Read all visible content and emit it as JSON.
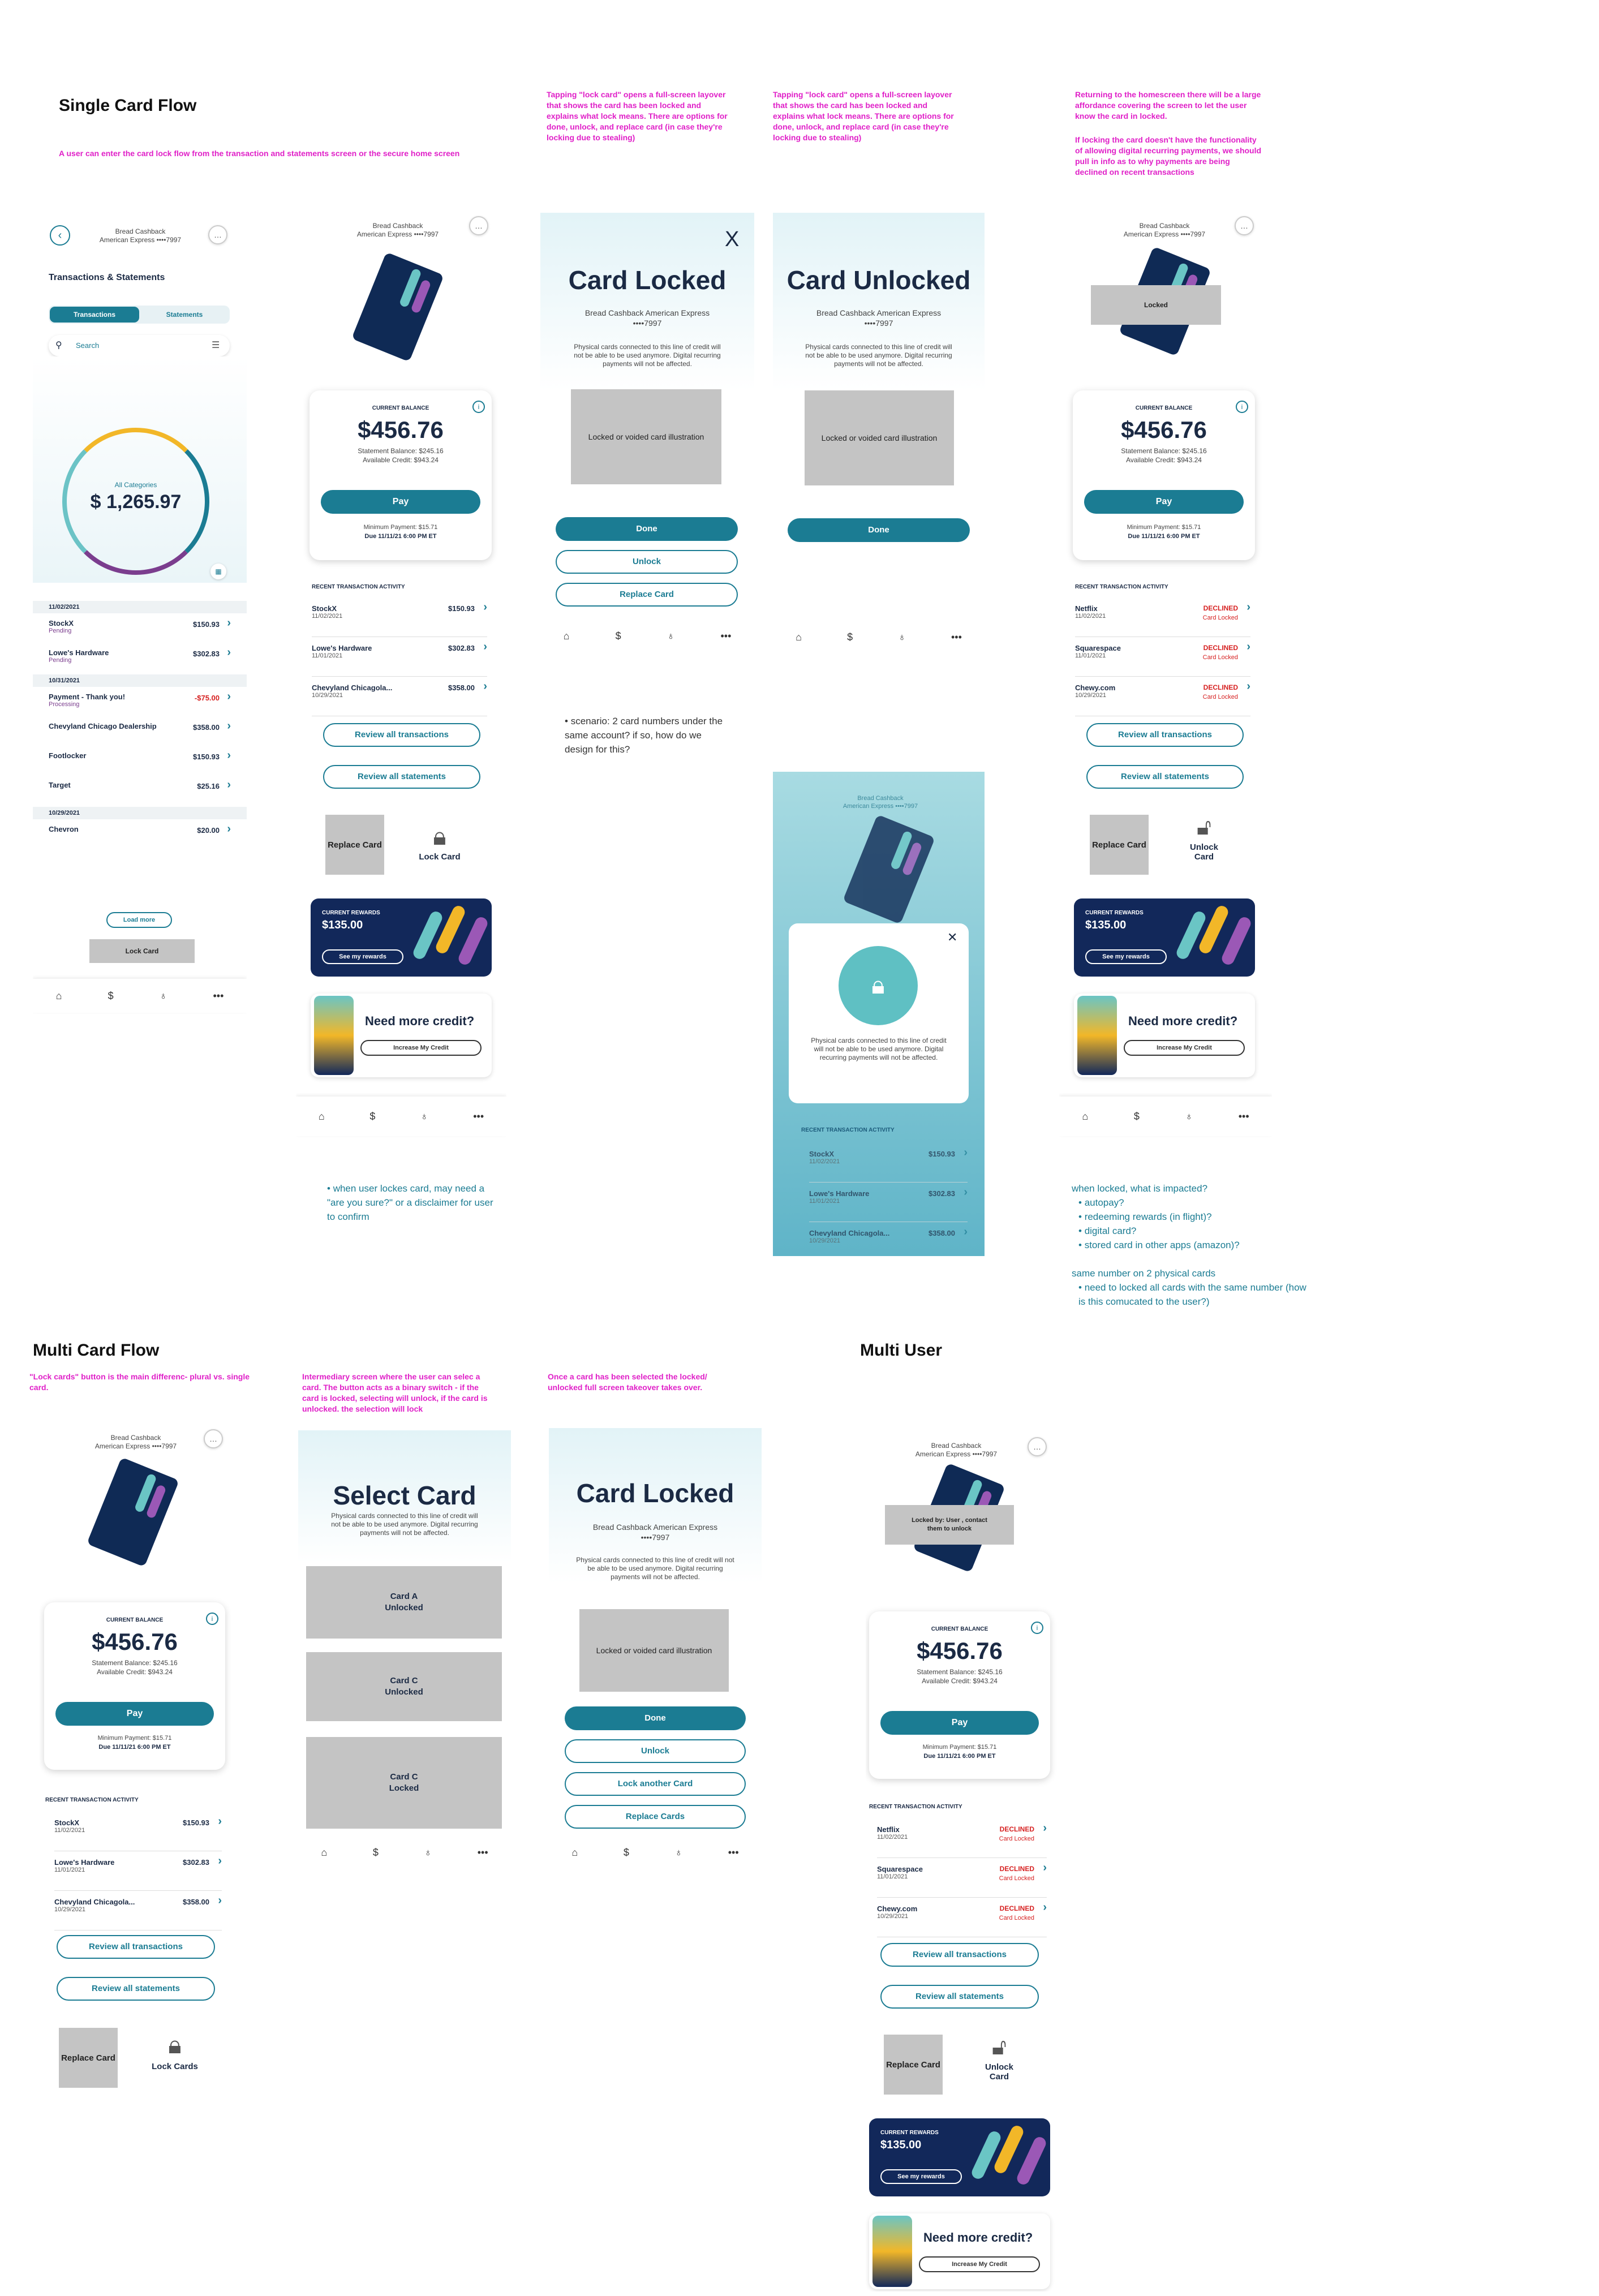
{
  "headers": {
    "single": "Single Card Flow",
    "multi": "Multi Card Flow",
    "multiuser": "Multi  User"
  },
  "notes": {
    "single_intro": "A user can enter the card lock flow from the transaction and statements screen or the secure home screen",
    "lock_overlay": "Tapping \"lock card\" opens a full-screen layover that shows the card has been locked and explains what lock means. There are options for done, unlock, and replace card (in case they're locking due to stealing)",
    "unlock_overlay": "Tapping \"lock card\" opens a full-screen layover that shows the card has been locked and explains what lock means. There are options for done, unlock, and replace card (in case they're locking due to stealing)",
    "home_return": "Returning to the homescreen there will be a large affordance covering the screen to let the user know the card in locked.",
    "home_return2": "If locking the card doesn't have the functionality of allowing digital recurring payments, we should pull in info as to why payments are being declined on recent transactions",
    "multi_intro": "\"Lock cards\" button is the main differenc- plural vs. single card.",
    "select_intro": "Intermediary screen where the user can selec a card. The button acts as a binary switch - if the card is locked, selecting will unlock, if the card is unlocked. the selection will lock",
    "takeover": "Once a card has been selected the locked/ unlocked full screen takeover takes over."
  },
  "comments": {
    "scenario": "scenario: 2 card numbers under the same account? if so, how do we design for this?",
    "confirm": "when user lockes card, may need a \"are you sure?\" or a disclaimer for user to confirm",
    "impacted_title": "when locked, what is impacted?",
    "impacted": [
      "autopay?",
      "redeeming rewards (in flight)?",
      "digital card?",
      "stored card in other apps (amazon)?"
    ],
    "same_number": "same number on 2 physical cards",
    "same_number_sub": "need to locked all cards with the same number (how is this comucated to the user?)"
  },
  "account": {
    "name": "Bread Cashback",
    "number": "American Express ••••7997",
    "full": "Bread Cashback American Express ••••7997"
  },
  "balance": {
    "label": "CURRENT BALANCE",
    "amount": "$456.76",
    "statement": "Statement Balance: $245.16",
    "available": "Available Credit: $943.24",
    "pay": "Pay",
    "minimum": "Minimum Payment: $15.71",
    "due": "Due 11/11/21 6:00 PM ET"
  },
  "recent_label": "RECENT TRANSACTION ACTIVITY",
  "recent": [
    {
      "name": "StockX",
      "date": "11/02/2021",
      "amount": "$150.93"
    },
    {
      "name": "Lowe's Hardware",
      "date": "11/01/2021",
      "amount": "$302.83"
    },
    {
      "name": "Chevyland Chicagola...",
      "date": "10/29/2021",
      "amount": "$358.00"
    }
  ],
  "declined": [
    {
      "name": "Netflix",
      "date": "11/02/2021"
    },
    {
      "name": "Squarespace",
      "date": "11/01/2021"
    },
    {
      "name": "Chewy.com",
      "date": "10/29/2021"
    }
  ],
  "declined_label": "DECLINED",
  "card_locked_label": "Card Locked",
  "review_tx": "Review all transactions",
  "review_st": "Review all statements",
  "replace_card": "Replace Card",
  "lock_card": "Lock Card",
  "unlock_card": "Unlock Card",
  "lock_cards": "Lock Cards",
  "rewards": {
    "label": "CURRENT REWARDS",
    "amount": "$135.00",
    "btn": "See my rewards"
  },
  "credit": {
    "title": "Need more credit?",
    "btn": "Increase My Credit"
  },
  "locked_badge": "Locked",
  "locked_by": "Locked by: User , contact them to unlock",
  "tx_screen": {
    "title": "Transactions & Statements",
    "tab1": "Transactions",
    "tab2": "Statements",
    "search": "Search",
    "categories": "All Categories",
    "total": "$ 1,265.97",
    "groups": [
      {
        "date": "11/02/2021",
        "items": [
          {
            "name": "StockX",
            "sub": "Pending",
            "amount": "$150.93"
          },
          {
            "name": "Lowe's Hardware",
            "sub": "Pending",
            "amount": "$302.83"
          }
        ]
      },
      {
        "date": "10/31/2021",
        "items": [
          {
            "name": "Payment - Thank you!",
            "sub": "Processing",
            "amount": "-$75.00"
          },
          {
            "name": "Chevyland Chicago Dealership",
            "sub": "",
            "amount": "$358.00"
          },
          {
            "name": "Footlocker",
            "sub": "",
            "amount": "$150.93"
          },
          {
            "name": "Target",
            "sub": "",
            "amount": "$25.16"
          }
        ]
      },
      {
        "date": "10/29/2021",
        "items": [
          {
            "name": "Chevron",
            "sub": "",
            "amount": "$20.00"
          }
        ]
      }
    ],
    "load_more": "Load more",
    "lock_card": "Lock Card"
  },
  "overlay": {
    "locked": "Card Locked",
    "unlocked": "Card Unlocked",
    "close": "X",
    "account": "Bread Cashback American Express ••••7997",
    "explain": "Physical cards connected to this line of credit will not be able to be used anymore. Digital recurring payments will not be affected.",
    "illustration": "Locked or voided card illustration",
    "done": "Done",
    "unlock": "Unlock",
    "replace": "Replace Card",
    "lock_another": "Lock another Card",
    "replace_cards": "Replace Cards"
  },
  "select": {
    "title": "Select Card",
    "explain": "Physical cards connected to this line of credit will not be able to be used anymore. Digital recurring payments will not be affected.",
    "cards": [
      "Card A Unlocked",
      "Card C Unlocked",
      "Card C Locked"
    ]
  },
  "modal": {
    "explain": "Physical cards connected to this line of credit will not be able to be used anymore. Digital recurring payments will not be affected."
  },
  "colors": {
    "teal": "#1b7c93",
    "navy": "#12285a",
    "magenta": "#e020c8",
    "declined": "#d62020"
  }
}
